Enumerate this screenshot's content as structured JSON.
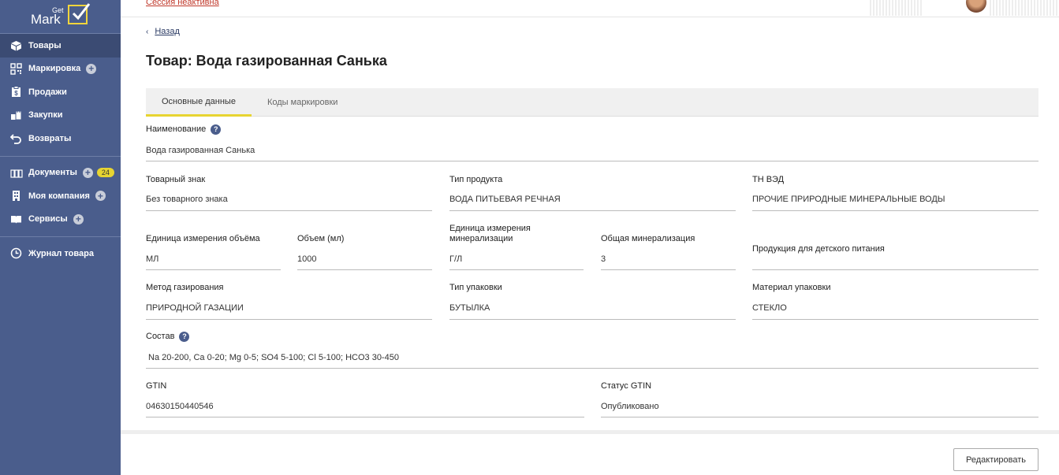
{
  "logo": {
    "top": "Get",
    "main": "Mark"
  },
  "sidebar": {
    "items": [
      {
        "label": "Товары",
        "icon": "box-icon"
      },
      {
        "label": "Маркировка",
        "icon": "qr-code-icon"
      },
      {
        "label": "Продажи",
        "icon": "receipt-icon"
      },
      {
        "label": "Закупки",
        "icon": "shopping-bag-icon"
      },
      {
        "label": "Возвраты",
        "icon": "return-arrow-icon"
      },
      {
        "label": "Документы",
        "icon": "documents-icon",
        "badge": "24"
      },
      {
        "label": "Моя компания",
        "icon": "building-icon"
      },
      {
        "label": "Сервисы",
        "icon": "book-icon"
      },
      {
        "label": "Журнал товара",
        "icon": "clock-icon"
      }
    ]
  },
  "topbar": {
    "session": "Сессия неактивна"
  },
  "back_label": "Назад",
  "page_title": "Товар: Вода газированная Санька",
  "tabs": [
    "Основные данные",
    "Коды маркировки"
  ],
  "fields": {
    "name": {
      "label": "Наименование",
      "value": "Вода газированная Санька"
    },
    "trademark": {
      "label": "Товарный знак",
      "value": "Без товарного знака"
    },
    "product_type": {
      "label": "Тип продукта",
      "value": "ВОДА ПИТЬЕВАЯ РЕЧНАЯ"
    },
    "tnved": {
      "label": "ТН ВЭД",
      "value": "ПРОЧИЕ ПРИРОДНЫЕ МИНЕРАЛЬНЫЕ ВОДЫ"
    },
    "volume_unit": {
      "label": "Единица измерения объёма",
      "value": "МЛ"
    },
    "volume": {
      "label": "Объем (мл)",
      "value": "1000"
    },
    "mineral_unit": {
      "label_line1": "Единица измерения",
      "label_line2": "минерализации",
      "value": "Г/Л"
    },
    "mineralization": {
      "label": "Общая минерализация",
      "value": "3"
    },
    "baby_food": {
      "label": "Продукция для детского питания",
      "value": ""
    },
    "carbonation": {
      "label": "Метод газирования",
      "value": "ПРИРОДНОЙ ГАЗАЦИИ"
    },
    "package_type": {
      "label": "Тип упаковки",
      "value": "БУТЫЛКА"
    },
    "package_material": {
      "label": "Материал упаковки",
      "value": "СТЕКЛО"
    },
    "composition": {
      "label": "Состав",
      "value": "Na 20-200, Ca 0-20; Mg 0-5; SO4 5-100; Cl 5-100; HCO3 30-450"
    },
    "gtin": {
      "label": "GTIN",
      "value": "04630150440546"
    },
    "gtin_status": {
      "label": "Статус GTIN",
      "value": "Опубликовано"
    }
  },
  "edit_button": "Редактировать",
  "colors": {
    "sidebar": "#4a5d8c",
    "sidebar_active": "#3b4b73",
    "accent": "#e7d431",
    "session": "#c0392b"
  }
}
